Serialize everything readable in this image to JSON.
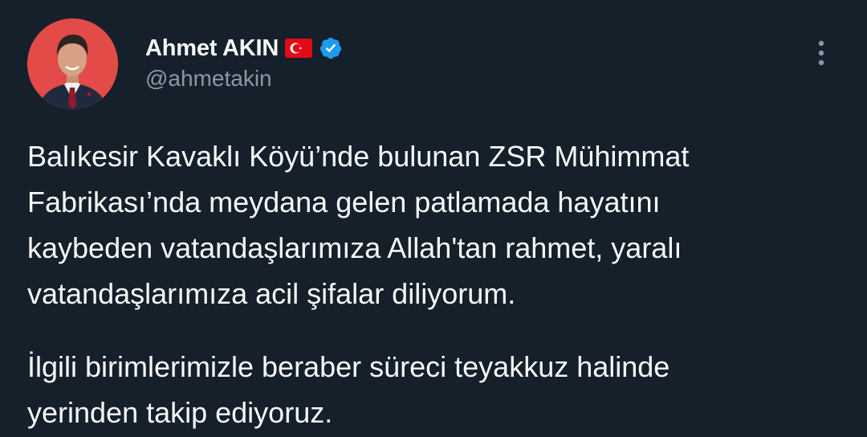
{
  "colors": {
    "background": "#15202b",
    "text_primary": "#f7f9f9",
    "text_secondary": "#8b98a5",
    "verified_blue": "#1d9bf0",
    "avatar_bg": "#e24b47",
    "flag_red": "#e30a17"
  },
  "tweet": {
    "author": {
      "display_name": "Ahmet AKIN",
      "handle": "@ahmetakin",
      "flag_icon": "turkey-flag-icon",
      "verified_icon": "verified-badge-icon"
    },
    "more_icon": "more-vertical-icon",
    "paragraphs": [
      "Balıkesir Kavaklı Köyü’nde bulunan ZSR Mühimmat\nFabrikası’nda meydana gelen patlamada hayatını\nkaybeden vatandaşlarımıza Allah'tan rahmet, yaralı\nvatandaşlarımıza acil şifalar diliyorum.",
      "İlgili birimlerimizle beraber süreci teyakkuz halinde\nyerinden takip ediyoruz."
    ]
  }
}
